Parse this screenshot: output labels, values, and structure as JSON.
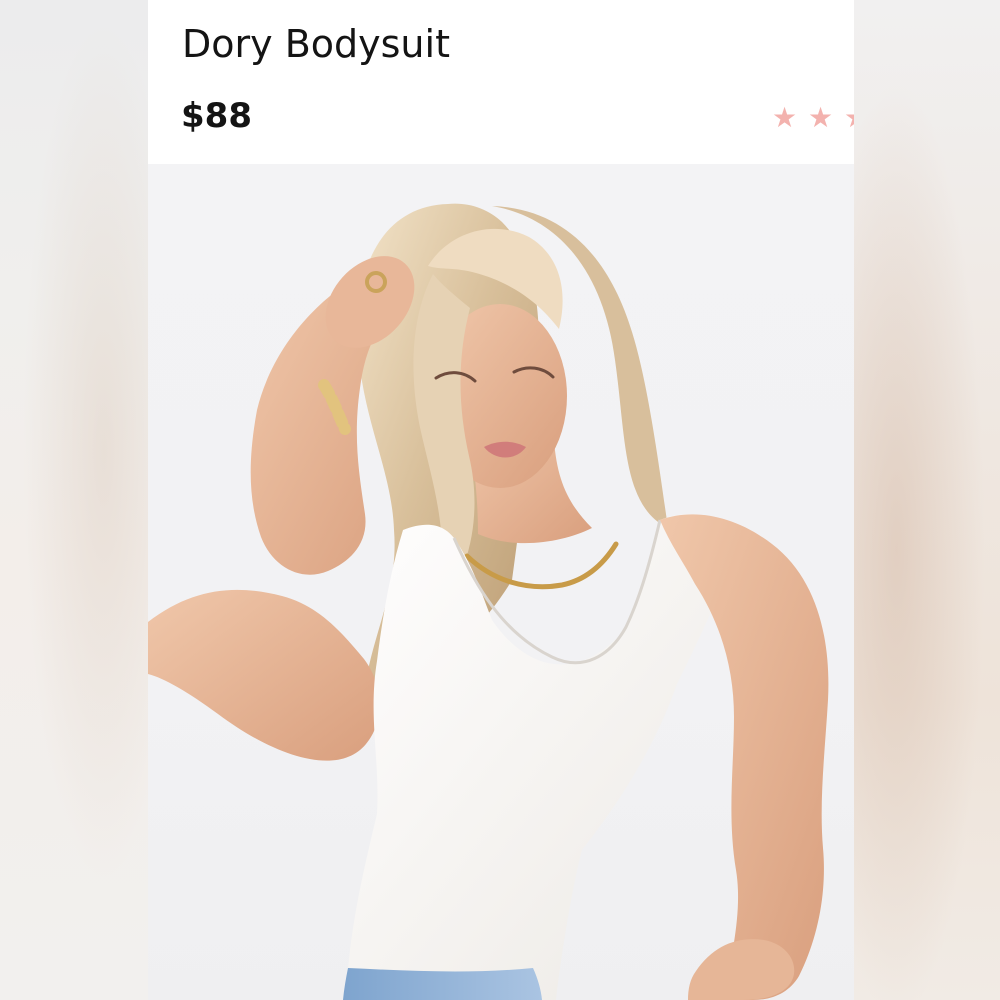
{
  "product": {
    "title": "Dory Bodysuit",
    "price": "$88",
    "rating_icons": [
      "star-icon",
      "star-icon",
      "star-icon"
    ]
  },
  "image": {
    "subject": "product-photo-model-white-bodysuit"
  },
  "colors": {
    "text": "#141414",
    "star": "#f3b2ae",
    "background": "#ffffff",
    "photo_bg": "#f2f2f4",
    "bodysuit": "#f8f6f3",
    "hair": "#d9c3a2",
    "skin": "#e9b99a",
    "denim": "#8fb2d8"
  }
}
